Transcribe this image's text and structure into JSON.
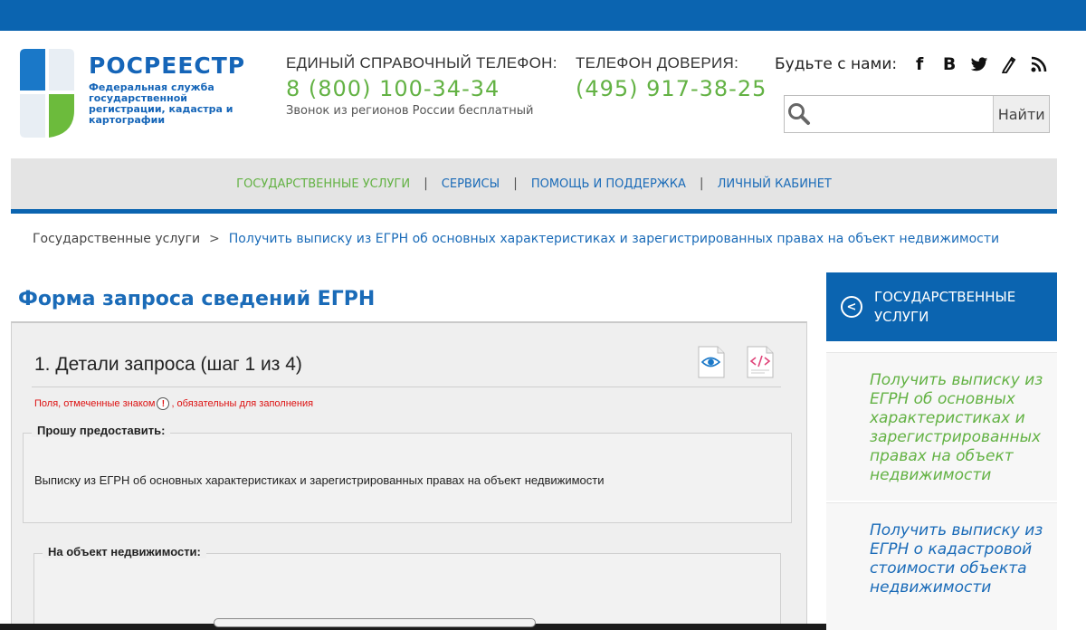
{
  "brand": {
    "name": "РОСРЕЕСТР",
    "subtitle": "Федеральная служба государственной регистрации, кадастра и картографии"
  },
  "phones": {
    "main_title": "ЕДИНЫЙ СПРАВОЧНЫЙ ТЕЛЕФОН:",
    "main_number": "8 (800) 100-34-34",
    "main_note": "Звонок из регионов России бесплатный",
    "trust_title": "ТЕЛЕФОН ДОВЕРИЯ:",
    "trust_number": "(495) 917-38-25"
  },
  "social": {
    "label": "Будьте с нами:",
    "icons": [
      "facebook-icon",
      "vk-icon",
      "twitter-icon",
      "edit-icon",
      "rss-icon"
    ]
  },
  "search": {
    "placeholder": "",
    "button": "Найти"
  },
  "nav": {
    "items": [
      {
        "label": "ГОСУДАРСТВЕННЫЕ УСЛУГИ",
        "active": true
      },
      {
        "label": "СЕРВИСЫ",
        "active": false
      },
      {
        "label": "ПОМОЩЬ И ПОДДЕРЖКА",
        "active": false
      },
      {
        "label": "ЛИЧНЫЙ КАБИНЕТ",
        "active": false
      }
    ]
  },
  "breadcrumb": {
    "root": "Государственные услуги",
    "separator": ">",
    "current": "Получить выписку из ЕГРН об основных характеристиках и зарегистрированных правах на объект недвижимости"
  },
  "page": {
    "title": "Форма запроса сведений ЕГРН"
  },
  "form": {
    "step_title": "1. Детали запроса (шаг 1 из 4)",
    "required_before": "Поля, отмеченные знаком",
    "required_mark": "!",
    "required_after": ", обязательны для заполнения",
    "fieldset1_legend": "Прошу предоставить:",
    "fieldset1_text": "Выписку из ЕГРН об основных характеристиках и зарегистрированных правах на объект недвижимости",
    "fieldset2_legend": "На объект недвижимости:"
  },
  "sidebar": {
    "header": "ГОСУДАРСТВЕННЫЕ УСЛУГИ",
    "back_glyph": "<",
    "links": [
      "Получить выписку из ЕГРН об основных характеристиках и зарегистрированных правах на объект недвижимости",
      "Получить выписку из ЕГРН о кадастровой стоимости объекта недвижимости"
    ]
  },
  "colors": {
    "brand_blue": "#0b64b0",
    "accent_green": "#63b244",
    "link_blue": "#1a6bb8",
    "required_red": "#dd1111"
  }
}
